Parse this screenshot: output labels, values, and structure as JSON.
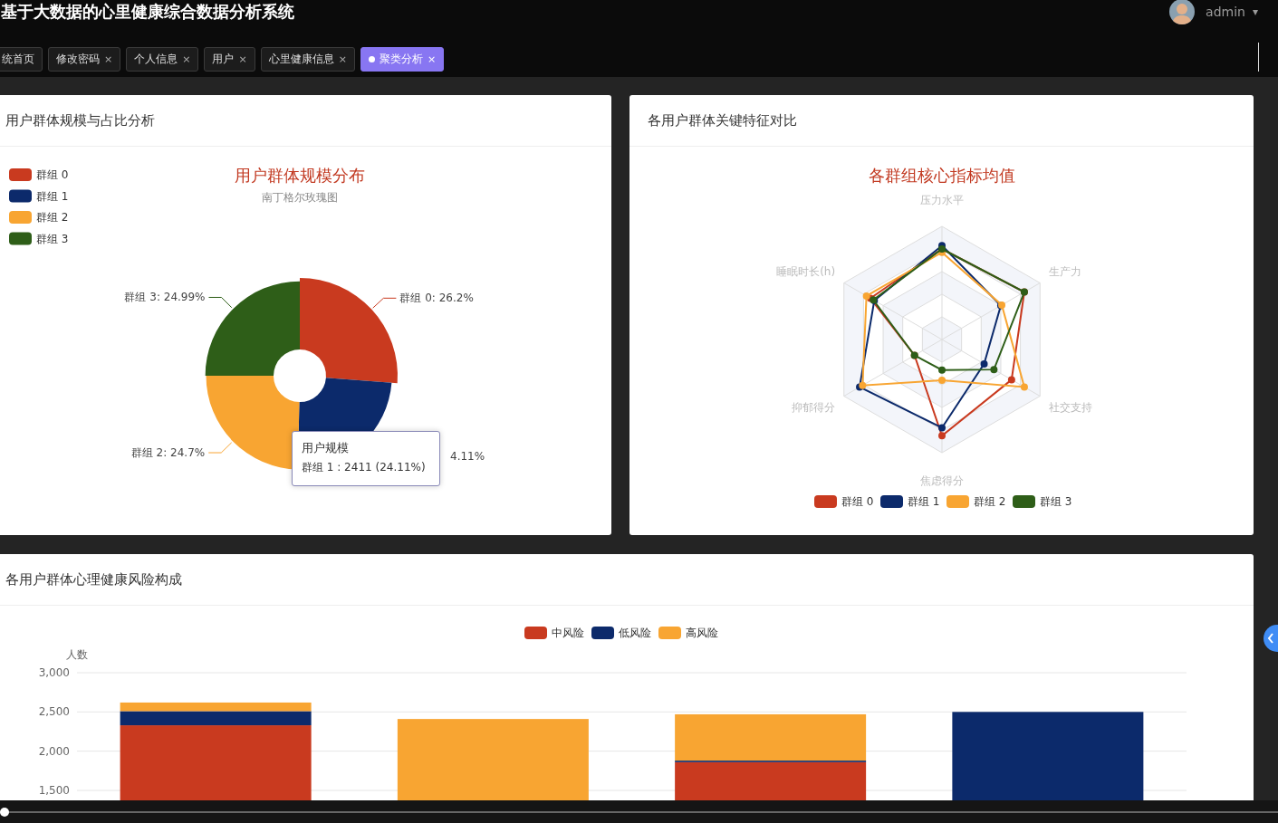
{
  "header": {
    "title": "基于大数据的心里健康综合数据分析系统",
    "user": "admin",
    "caret": "▾"
  },
  "tabs": [
    {
      "label": "统首页",
      "selected": false
    },
    {
      "label": "修改密码",
      "close": "×",
      "selected": false
    },
    {
      "label": "个人信息",
      "close": "×",
      "selected": false
    },
    {
      "label": "用户",
      "close": "×",
      "selected": false
    },
    {
      "label": "心里健康信息",
      "close": "×",
      "selected": false
    },
    {
      "label": "聚类分析",
      "close": "×",
      "selected": true
    }
  ],
  "size_card": {
    "title": "用户群体规模与占比分析",
    "subtitle": "南丁格尔玫瑰图",
    "slice_labels": [
      "群组 3: 24.99%",
      "群组 0: 26.2%",
      "群组 2: 24.7%",
      "4.11%"
    ],
    "chart_data": {
      "type": "donut",
      "title": "用户群体规模分布",
      "categories": [
        "群组 0",
        "群组 1",
        "群组 2",
        "群组 3"
      ],
      "values": [
        26.2,
        24.11,
        24.7,
        24.99
      ],
      "colors": [
        "#c93a1f",
        "#0c2a6b",
        "#f8a532",
        "#2e5e18"
      ],
      "legend": "left"
    },
    "tooltip": {
      "title": "用户规模",
      "text": "群组 1 : 2411 (24.11%)"
    }
  },
  "feature_card": {
    "title": "各用户群体关键特征对比",
    "chart_title": "各群组核心指标均值",
    "axes": [
      "压力水平",
      "生产力",
      "社交支持",
      "焦虑得分",
      "抑郁得分",
      "睡眠时长(h)"
    ],
    "legend": [
      {
        "name": "群组 0",
        "color": "#c93a1f"
      },
      {
        "name": "群组 1",
        "color": "#0c2a6b"
      },
      {
        "name": "群组 2",
        "color": "#f8a532"
      },
      {
        "name": "群组 3",
        "color": "#2e5e18"
      }
    ]
  },
  "risk_card": {
    "title": "各用户群体心理健康风险构成",
    "chart_data": {
      "type": "bar",
      "stacked": true,
      "legend": "top",
      "grid": true,
      "ylabel": "人数",
      "ylim": [
        0,
        3000
      ],
      "yticks": [
        {
          "value": 1500,
          "label": "1,500"
        },
        {
          "value": 2000,
          "label": "2,000"
        },
        {
          "value": 2500,
          "label": "2,500"
        },
        {
          "value": 3000,
          "label": "3,000"
        }
      ],
      "series": [
        {
          "name": "中风险",
          "color": "#c93a1f",
          "values": [
            2330,
            0,
            1860,
            0
          ]
        },
        {
          "name": "低风险",
          "color": "#0c2a6b",
          "values": [
            180,
            0,
            20,
            2500
          ]
        },
        {
          "name": "高风险",
          "color": "#f8a532",
          "values": [
            110,
            2410,
            590,
            0
          ]
        }
      ]
    }
  },
  "player": {
    "level": 0
  }
}
